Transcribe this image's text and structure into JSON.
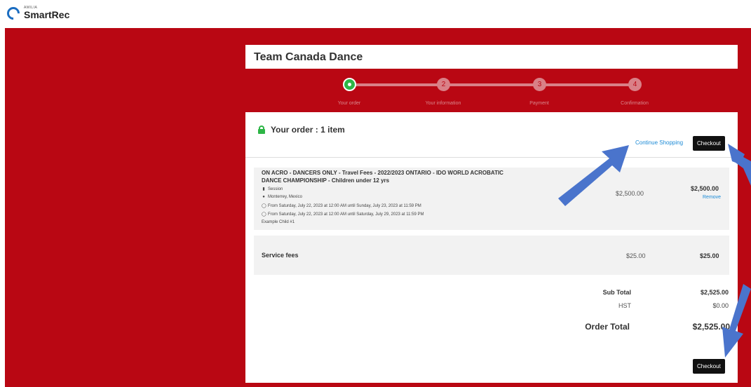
{
  "app": {
    "logo_small": "AMILIA",
    "logo_main": "SmartRec"
  },
  "page": {
    "title": "Team Canada Dance"
  },
  "stepper": {
    "steps": [
      {
        "num": "",
        "label": "Your order"
      },
      {
        "num": "2",
        "label": "Your information"
      },
      {
        "num": "3",
        "label": "Payment"
      },
      {
        "num": "4",
        "label": "Confirmation"
      }
    ]
  },
  "order": {
    "heading": "Your order : 1 item",
    "continue_label": "Continue Shopping",
    "checkout_label": "Checkout",
    "item": {
      "title": "ON ACRO - DANCERS ONLY - Travel Fees - 2022/2023 ONTARIO - IDO WORLD ACROBATIC DANCE CHAMPIONSHIP - Children under 12 yrs",
      "type": "Session",
      "location": "Monterrey, Mexico",
      "schedule1": "From Saturday, July 22, 2023 at 12:00 AM until Sunday, July 23, 2023 at 11:59 PM",
      "schedule2": "From Saturday, July 22, 2023 at 12:00 AM until Saturday, July 29, 2023 at 11:59 PM",
      "participant": "Example Child #1",
      "price": "$2,500.00",
      "total": "$2,500.00",
      "remove_label": "Remove"
    },
    "fees": {
      "label": "Service fees",
      "price": "$25.00",
      "total": "$25.00"
    },
    "summary": {
      "subtotal_label": "Sub Total",
      "subtotal": "$2,525.00",
      "tax_label": "HST",
      "tax": "$0.00",
      "total_label": "Order Total",
      "total": "$2,525.00"
    }
  },
  "colors": {
    "brand_red": "#b90713",
    "accent_blue": "#1b8ad6",
    "success_green": "#2db546",
    "arrow_blue": "#4a74cc"
  }
}
